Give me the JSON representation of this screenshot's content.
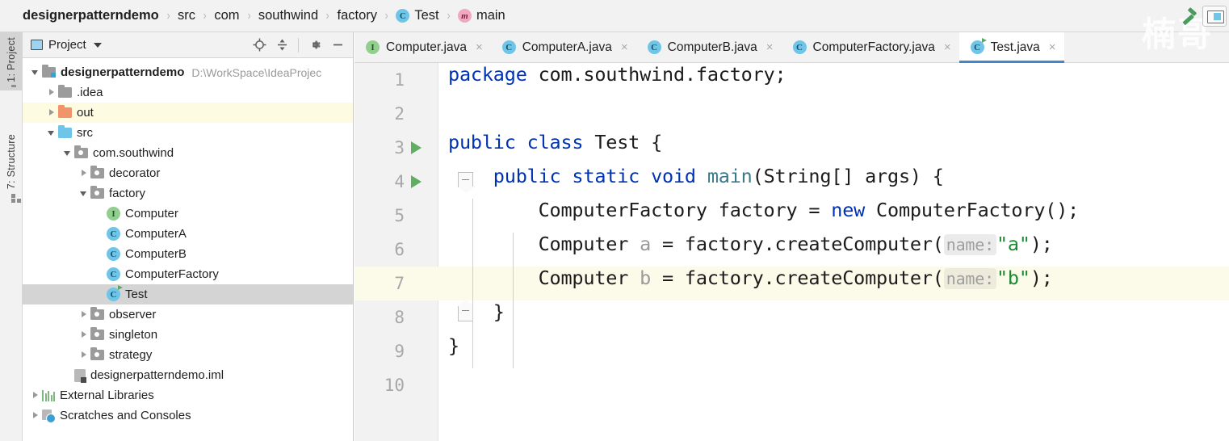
{
  "breadcrumb": {
    "items": [
      {
        "label": "designerpatterndemo",
        "icon": "none",
        "root": true
      },
      {
        "label": "src",
        "icon": "none",
        "root": false
      },
      {
        "label": "com",
        "icon": "none",
        "root": false
      },
      {
        "label": "southwind",
        "icon": "none",
        "root": false
      },
      {
        "label": "factory",
        "icon": "none",
        "root": false
      },
      {
        "label": "Test",
        "icon": "java-class-icon",
        "root": false
      },
      {
        "label": "main",
        "icon": "java-method-icon",
        "root": false
      }
    ],
    "separator": "›"
  },
  "toolbar_right": {
    "build_icon": "hammer-icon",
    "panel_icon": "restore-layout-icon",
    "watermark": "楠哥"
  },
  "left_strip": {
    "tools": [
      {
        "label": "1: Project",
        "icon": "project-folder-icon",
        "active": true
      },
      {
        "label": "7: Structure",
        "icon": "structure-icon",
        "active": false
      }
    ]
  },
  "project_panel": {
    "title": "Project",
    "window_icon": "project-window-icon",
    "dropdown_icon": "chevron-down-icon",
    "actions": [
      {
        "name": "locate-icon",
        "title": "Select Opened File"
      },
      {
        "name": "collapse-all-icon",
        "title": "Collapse All"
      },
      {
        "name": "gear-icon",
        "title": "Settings"
      },
      {
        "name": "minimize-icon",
        "title": "Hide"
      }
    ],
    "tree": [
      {
        "label": "designerpatterndemo",
        "path": "D:\\WorkSpace\\IdeaProjec",
        "indent": 0,
        "twisty": "down",
        "icon": "folder-module",
        "bold": true,
        "state": "none"
      },
      {
        "label": ".idea",
        "path": "",
        "indent": 1,
        "twisty": "right",
        "icon": "folder-gray",
        "bold": false,
        "state": "none"
      },
      {
        "label": "out",
        "path": "",
        "indent": 1,
        "twisty": "right",
        "icon": "folder-orange",
        "bold": false,
        "state": "highlight"
      },
      {
        "label": "src",
        "path": "",
        "indent": 1,
        "twisty": "down",
        "icon": "folder-blue",
        "bold": false,
        "state": "none"
      },
      {
        "label": "com.southwind",
        "path": "",
        "indent": 2,
        "twisty": "down",
        "icon": "folder-package",
        "bold": false,
        "state": "none"
      },
      {
        "label": "decorator",
        "path": "",
        "indent": 3,
        "twisty": "right",
        "icon": "folder-package",
        "bold": false,
        "state": "none"
      },
      {
        "label": "factory",
        "path": "",
        "indent": 3,
        "twisty": "down",
        "icon": "folder-package",
        "bold": false,
        "state": "none"
      },
      {
        "label": "Computer",
        "path": "",
        "indent": 4,
        "twisty": "none",
        "icon": "java-interface-icon",
        "bold": false,
        "state": "none"
      },
      {
        "label": "ComputerA",
        "path": "",
        "indent": 4,
        "twisty": "none",
        "icon": "java-class-icon",
        "bold": false,
        "state": "none"
      },
      {
        "label": "ComputerB",
        "path": "",
        "indent": 4,
        "twisty": "none",
        "icon": "java-class-icon",
        "bold": false,
        "state": "none"
      },
      {
        "label": "ComputerFactory",
        "path": "",
        "indent": 4,
        "twisty": "none",
        "icon": "java-class-icon",
        "bold": false,
        "state": "none"
      },
      {
        "label": "Test",
        "path": "",
        "indent": 4,
        "twisty": "none",
        "icon": "java-class-runnable-icon",
        "bold": false,
        "state": "selected"
      },
      {
        "label": "observer",
        "path": "",
        "indent": 3,
        "twisty": "right",
        "icon": "folder-package",
        "bold": false,
        "state": "none"
      },
      {
        "label": "singleton",
        "path": "",
        "indent": 3,
        "twisty": "right",
        "icon": "folder-package",
        "bold": false,
        "state": "none"
      },
      {
        "label": "strategy",
        "path": "",
        "indent": 3,
        "twisty": "right",
        "icon": "folder-package",
        "bold": false,
        "state": "none"
      },
      {
        "label": "designerpatterndemo.iml",
        "path": "",
        "indent": 2,
        "twisty": "none",
        "icon": "iml-file-icon",
        "bold": false,
        "state": "none"
      },
      {
        "label": "External Libraries",
        "path": "",
        "indent": 0,
        "twisty": "right",
        "icon": "libraries-icon",
        "bold": false,
        "state": "none"
      },
      {
        "label": "Scratches and Consoles",
        "path": "",
        "indent": 0,
        "twisty": "right",
        "icon": "scratches-icon",
        "bold": false,
        "state": "none"
      }
    ]
  },
  "editor": {
    "tabs": [
      {
        "label": "Computer.java",
        "icon": "java-interface-icon",
        "active": false,
        "close": "×"
      },
      {
        "label": "ComputerA.java",
        "icon": "java-class-icon",
        "active": false,
        "close": "×"
      },
      {
        "label": "ComputerB.java",
        "icon": "java-class-icon",
        "active": false,
        "close": "×"
      },
      {
        "label": "ComputerFactory.java",
        "icon": "java-class-icon",
        "active": false,
        "close": "×"
      },
      {
        "label": "Test.java",
        "icon": "java-class-runnable-icon",
        "active": true,
        "close": "×"
      }
    ],
    "lines": [
      {
        "num": "1",
        "run": false,
        "fold": "none",
        "caret": false,
        "tokens": [
          {
            "t": "package ",
            "c": "kw"
          },
          {
            "t": "com.southwind.factory;",
            "c": "plain"
          }
        ]
      },
      {
        "num": "2",
        "run": false,
        "fold": "none",
        "caret": false,
        "tokens": []
      },
      {
        "num": "3",
        "run": true,
        "fold": "none",
        "caret": false,
        "tokens": [
          {
            "t": "public class ",
            "c": "kw"
          },
          {
            "t": "Test {",
            "c": "plain"
          }
        ]
      },
      {
        "num": "4",
        "run": true,
        "fold": "open",
        "caret": false,
        "tokens": [
          {
            "t": "    ",
            "c": "plain"
          },
          {
            "t": "public static void ",
            "c": "kw"
          },
          {
            "t": "main",
            "c": "mth"
          },
          {
            "t": "(String[] args) {",
            "c": "plain"
          }
        ]
      },
      {
        "num": "5",
        "run": false,
        "fold": "none",
        "caret": false,
        "tokens": [
          {
            "t": "        ComputerFactory factory = ",
            "c": "plain"
          },
          {
            "t": "new ",
            "c": "kw"
          },
          {
            "t": "ComputerFactory();",
            "c": "plain"
          }
        ]
      },
      {
        "num": "6",
        "run": false,
        "fold": "none",
        "caret": false,
        "tokens": [
          {
            "t": "        Computer ",
            "c": "plain"
          },
          {
            "t": "a",
            "c": "lvar"
          },
          {
            "t": " = factory.createComputer(",
            "c": "plain"
          },
          {
            "t": "name:",
            "c": "hint"
          },
          {
            "t": "\"a\"",
            "c": "str"
          },
          {
            "t": ");",
            "c": "plain"
          }
        ]
      },
      {
        "num": "7",
        "run": false,
        "fold": "none",
        "caret": true,
        "tokens": [
          {
            "t": "        Computer ",
            "c": "plain"
          },
          {
            "t": "b",
            "c": "lvar"
          },
          {
            "t": " = factory.createComputer(",
            "c": "plain"
          },
          {
            "t": "name:",
            "c": "hint"
          },
          {
            "t": "\"b\"",
            "c": "str"
          },
          {
            "t": ");",
            "c": "plain"
          }
        ]
      },
      {
        "num": "8",
        "run": false,
        "fold": "end",
        "caret": false,
        "tokens": [
          {
            "t": "    }",
            "c": "plain"
          }
        ]
      },
      {
        "num": "9",
        "run": false,
        "fold": "none",
        "caret": false,
        "tokens": [
          {
            "t": "}",
            "c": "plain"
          }
        ]
      },
      {
        "num": "10",
        "run": false,
        "fold": "none",
        "caret": false,
        "tokens": []
      }
    ]
  },
  "colors": {
    "keyword": "#0033b3",
    "string": "#1a8a32",
    "method": "#3a7a88",
    "local_var": "#9a9a9a",
    "caret_line": "#fcfae8",
    "selection": "#d4d4d4",
    "tab_underline": "#4387c7",
    "run_arrow": "#5fae61"
  }
}
